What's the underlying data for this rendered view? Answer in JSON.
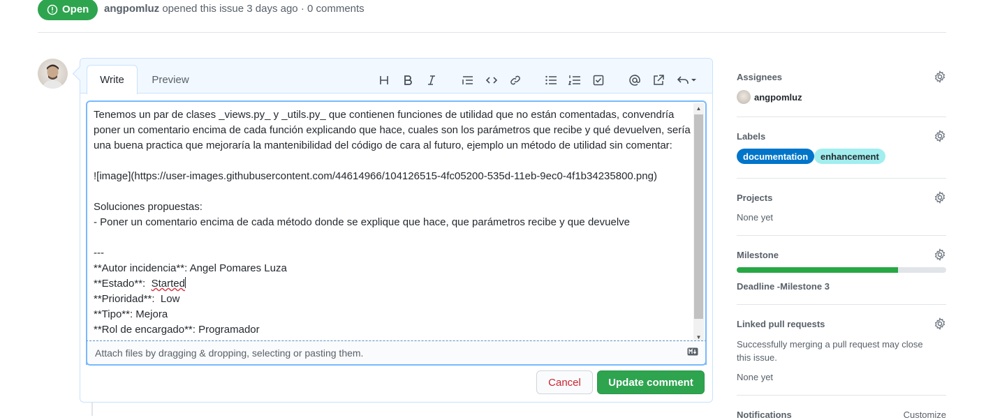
{
  "issue": {
    "state": "Open",
    "author": "angpomluz",
    "meta_text": "opened this issue 3 days ago · 0 comments"
  },
  "editor": {
    "tab_write": "Write",
    "tab_preview": "Preview",
    "toolbar_icons": [
      "heading-icon",
      "bold-icon",
      "italic-icon",
      "quote-icon",
      "code-icon",
      "link-icon",
      "unordered-list-icon",
      "ordered-list-icon",
      "task-list-icon",
      "mention-icon",
      "cross-reference-icon",
      "saved-replies-icon"
    ],
    "text_main": "Tenemos un par de clases _views.py_ y _utils.py_ que contienen funciones de utilidad que no están comentadas, convendría poner un comentario encima de cada función explicando que hace, cuales son los parámetros que recibe y qué devuelven, sería una buena practica que mejoraría la mantenibilidad del código de cara al futuro, ejemplo un método de utilidad sin comentar:\n\n![image](https://user-images.githubusercontent.com/44614966/104126515-4fc05200-535d-11eb-9ec0-4f1b34235800.png)\n\nSoluciones propuestas:\n- Poner un comentario encima de cada método donde se explique que hace, que parámetros recibe y que devuelve\n\n---\n**Autor incidencia**: Angel Pomares Luza\n**Estado**:  ",
    "text_spell": "Started",
    "text_tail": "\n**Prioridad**:  Low\n**Tipo**: Mejora\n**Rol de encargado**: Programador",
    "attach_hint": "Attach files by dragging & dropping, selecting or pasting them.",
    "cancel_label": "Cancel",
    "update_label": "Update comment"
  },
  "sidebar": {
    "assignees": {
      "title": "Assignees",
      "user": "angpomluz"
    },
    "labels": {
      "title": "Labels",
      "items": [
        {
          "name": "documentation",
          "bg": "#0075ca",
          "fg": "#ffffff"
        },
        {
          "name": "enhancement",
          "bg": "#a2eeef",
          "fg": "#24292e"
        }
      ]
    },
    "projects": {
      "title": "Projects",
      "value": "None yet"
    },
    "milestone": {
      "title": "Milestone",
      "progress_percent": 77,
      "name": "Deadline -Milestone 3"
    },
    "linked_prs": {
      "title": "Linked pull requests",
      "description": "Successfully merging a pull request may close this issue.",
      "value": "None yet"
    },
    "notifications": {
      "title": "Notifications",
      "action": "Customize"
    }
  },
  "colors": {
    "open_green": "#2ea44f",
    "focus_blue": "#79b8ff",
    "cancel_red": "#cb2431"
  }
}
